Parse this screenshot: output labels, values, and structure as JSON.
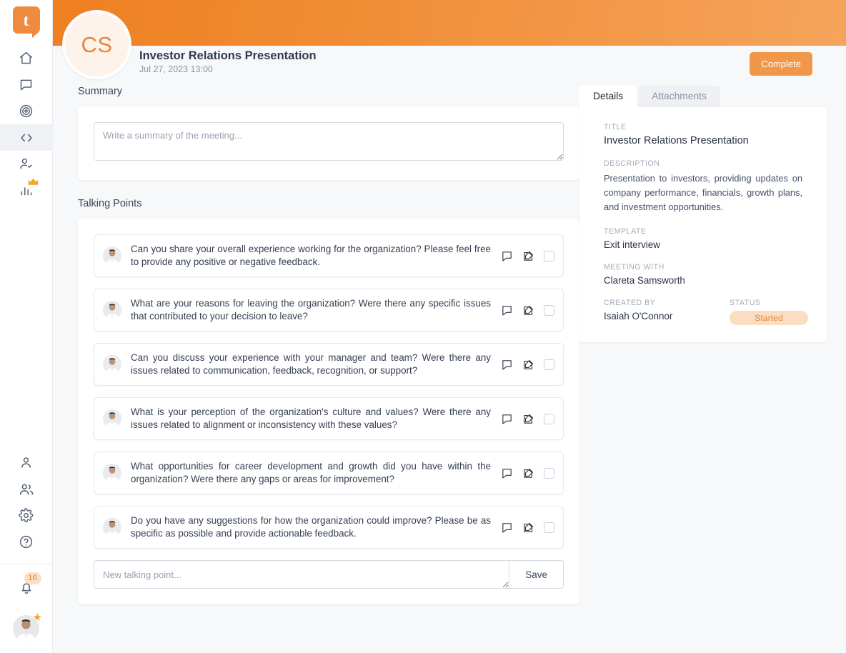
{
  "brand": {
    "logo_letter": "t",
    "accent": "#f1974a",
    "header_gradient_from": "#ef7f22",
    "header_gradient_to": "#f5a45c"
  },
  "sidebar": {
    "nav_items": [
      {
        "name": "home-icon",
        "label": "Home"
      },
      {
        "name": "chat-icon",
        "label": "Messages"
      },
      {
        "name": "target-icon",
        "label": "Goals"
      },
      {
        "name": "code-icon",
        "label": "Meetings",
        "active": true
      },
      {
        "name": "user-check-icon",
        "label": "Reviews"
      },
      {
        "name": "chart-bar-icon",
        "label": "Analytics",
        "premium": true
      }
    ],
    "bottom_items": [
      {
        "name": "person-icon",
        "label": "Profile"
      },
      {
        "name": "people-icon",
        "label": "Team"
      },
      {
        "name": "gear-icon",
        "label": "Settings"
      },
      {
        "name": "help-icon",
        "label": "Help"
      }
    ],
    "notification_count": "16"
  },
  "header": {
    "avatar_initials": "CS",
    "title": "Investor Relations Presentation",
    "date": "Jul 27, 2023 13:00",
    "complete_button": "Complete"
  },
  "summary": {
    "heading": "Summary",
    "placeholder": "Write a summary of the meeting...",
    "value": ""
  },
  "talking_points": {
    "heading": "Talking Points",
    "items": [
      {
        "text": "Can you share your overall experience working for the organization? Please feel free to provide any positive or negative feedback."
      },
      {
        "text": "What are your reasons for leaving the organization? Were there any specific issues that contributed to your decision to leave?"
      },
      {
        "text": "Can you discuss your experience with your manager and team? Were there any issues related to communication, feedback, recognition, or support?"
      },
      {
        "text": "What is your perception of the organization's culture and values? Were there any issues related to alignment or inconsistency with these values?"
      },
      {
        "text": "What opportunities for career development and growth did you have within the organization? Were there any gaps or areas for improvement?"
      },
      {
        "text": "Do you have any suggestions for how the organization could improve? Please be as specific as possible and provide actionable feedback."
      }
    ],
    "new_placeholder": "New talking point...",
    "new_value": "",
    "save_label": "Save"
  },
  "details_panel": {
    "tabs": [
      {
        "label": "Details",
        "active": true
      },
      {
        "label": "Attachments",
        "active": false
      }
    ],
    "fields": {
      "title_label": "TITLE",
      "title_value": "Investor Relations Presentation",
      "description_label": "DESCRIPTION",
      "description_value": "Presentation to investors, providing updates on company performance, financials, growth plans, and investment opportunities.",
      "template_label": "TEMPLATE",
      "template_value": "Exit interview",
      "meeting_with_label": "MEETING WITH",
      "meeting_with_value": "Clareta Samsworth",
      "created_by_label": "CREATED BY",
      "created_by_value": "Isaiah O'Connor",
      "status_label": "STATUS",
      "status_value": "Started",
      "status_color": "#e2873c",
      "status_bg": "#fbdec2"
    }
  }
}
